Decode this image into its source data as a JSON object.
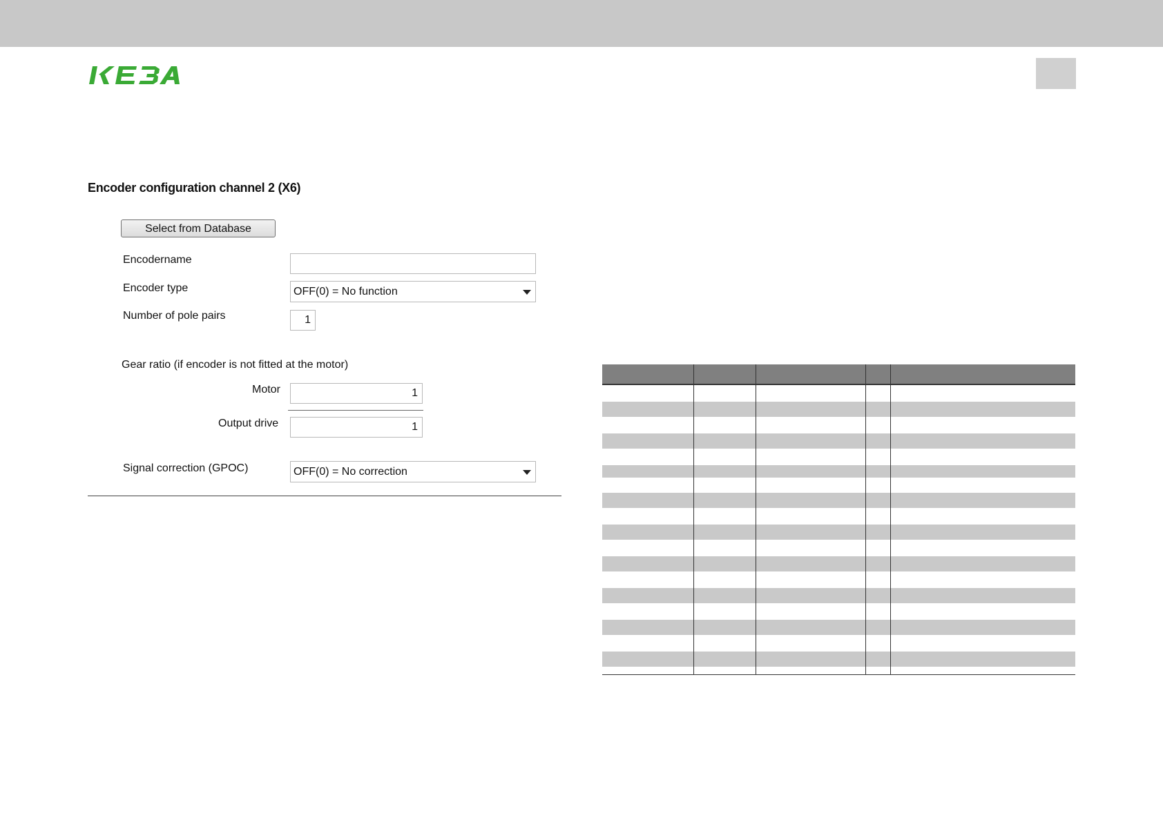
{
  "brand": {
    "logo_text": "KEBA",
    "logo_color": "#3aaa35"
  },
  "section": {
    "heading": "Encoder configuration channel 2 (X6)"
  },
  "form": {
    "select_db_label": "Select from Database",
    "encodername_label": "Encodername",
    "encodername_value": "",
    "encoder_type_label": "Encoder type",
    "encoder_type_value": "OFF(0) = No function",
    "pole_pairs_label": "Number of pole pairs",
    "pole_pairs_value": "1",
    "gear_ratio_label": "Gear ratio (if encoder is not fitted at the motor)",
    "motor_label": "Motor",
    "motor_value": "1",
    "output_drive_label": "Output drive",
    "output_drive_value": "1",
    "signal_correction_label": "Signal correction (GPOC)",
    "signal_correction_value": "OFF(0) = No correction"
  },
  "table": {
    "header_color": "#808080",
    "stripe_color": "#c9c9c9",
    "rows": [
      {
        "shade": "white"
      },
      {
        "shade": "grey"
      },
      {
        "shade": "white"
      },
      {
        "shade": "grey"
      },
      {
        "shade": "white"
      },
      {
        "shade": "grey"
      },
      {
        "shade": "white"
      },
      {
        "shade": "grey"
      },
      {
        "shade": "white"
      },
      {
        "shade": "grey"
      },
      {
        "shade": "white"
      },
      {
        "shade": "grey"
      },
      {
        "shade": "white"
      },
      {
        "shade": "grey"
      },
      {
        "shade": "white"
      },
      {
        "shade": "grey"
      },
      {
        "shade": "white"
      },
      {
        "shade": "grey"
      },
      {
        "shade": "white"
      }
    ]
  }
}
